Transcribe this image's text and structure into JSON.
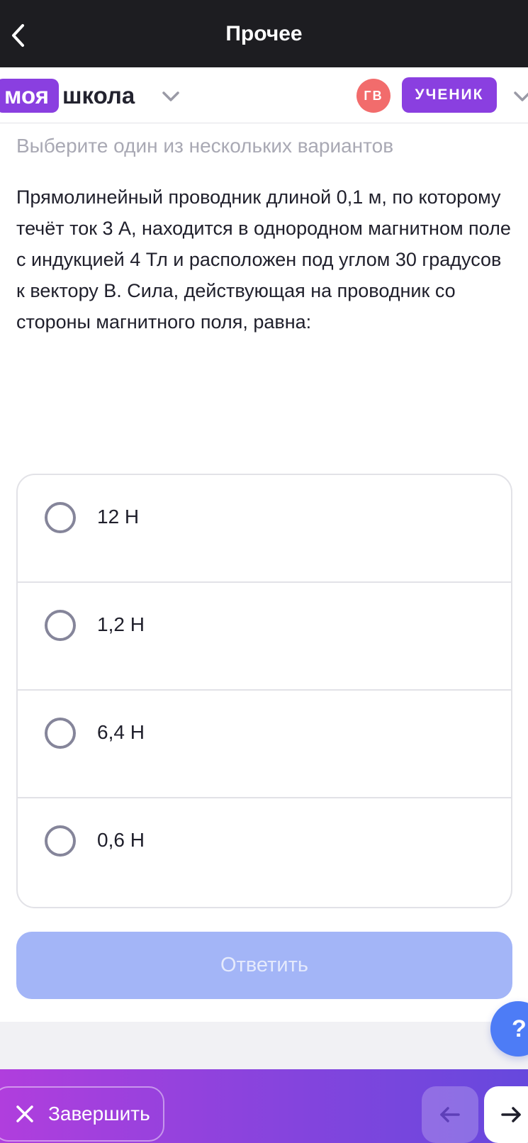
{
  "header": {
    "title": "Прочее"
  },
  "school_bar": {
    "brand_highlight": "моя",
    "brand_name": "школа",
    "avatar_initials": "ГВ",
    "role": "УЧЕНИК"
  },
  "task": {
    "hint": "Выберите один из нескольких вариантов",
    "question": "Прямолинейный проводник длиной 0,1 м, по которому течёт ток 3 А, находится в однородном магнитном поле с индукцией 4 Тл и расположен под углом 30 градусов к вектору В. Сила, действующая на проводник со стороны магнитного поля, равна:",
    "options": [
      {
        "label": "12 Н",
        "selected": false
      },
      {
        "label": "1,2 Н",
        "selected": false
      },
      {
        "label": "6,4 Н",
        "selected": false
      },
      {
        "label": "0,6 Н",
        "selected": false
      }
    ],
    "answer_label": "Ответить"
  },
  "help": {
    "label": "?"
  },
  "footer": {
    "finish_label": "Завершить"
  },
  "colors": {
    "accent_purple": "#8a3fe0",
    "avatar_red": "#f26c6c",
    "answer_disabled": "#a3b5f7",
    "help_blue": "#4d7cf6",
    "topbar": "#1d1d21"
  },
  "icons": {
    "back": "chevron-left-icon",
    "dropdown": "chevron-down-icon",
    "finish": "close-icon",
    "prev": "arrow-left-icon",
    "next": "arrow-right-icon"
  }
}
